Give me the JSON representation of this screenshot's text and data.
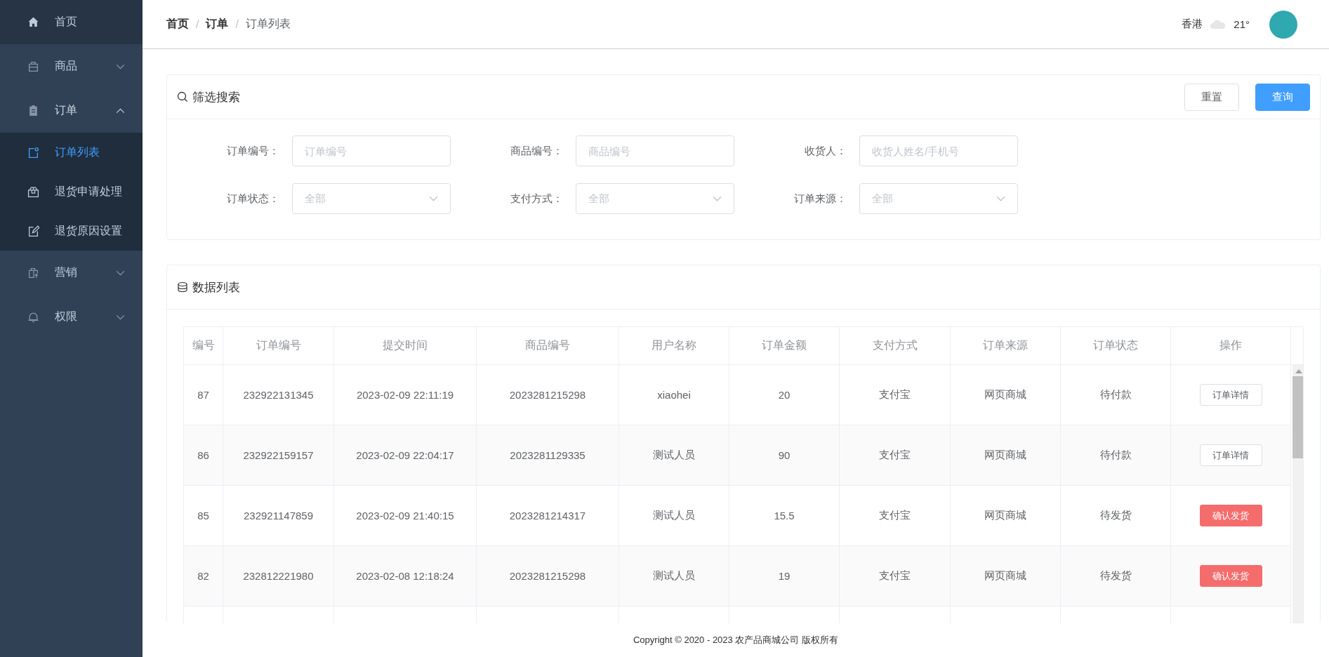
{
  "sidebar": {
    "items": [
      {
        "label": "首页",
        "selected": false
      },
      {
        "label": "商品",
        "expanded": false,
        "selected": false
      },
      {
        "label": "订单",
        "expanded": true,
        "selected": false,
        "children": [
          {
            "label": "订单列表",
            "selected": true
          },
          {
            "label": "退货申请处理",
            "selected": false
          },
          {
            "label": "退货原因设置",
            "selected": false
          }
        ]
      },
      {
        "label": "营销",
        "expanded": false,
        "selected": false
      },
      {
        "label": "权限",
        "expanded": false,
        "selected": false
      }
    ]
  },
  "breadcrumb": [
    {
      "label": "首页",
      "current": false
    },
    {
      "separator": "/",
      "label": "订单",
      "current": false
    },
    {
      "separator": "/",
      "label": "订单列表",
      "current": true
    }
  ],
  "header": {
    "city": "香港",
    "temperature": "21°"
  },
  "filter": {
    "title": "筛选搜索",
    "buttons": [
      {
        "label": "重置",
        "kind": "default"
      },
      {
        "label": "查询",
        "kind": "primary"
      }
    ],
    "fields": [
      {
        "label": "订单编号：",
        "kind": "input",
        "placeholder": "订单编号"
      },
      {
        "label": "商品编号：",
        "kind": "input",
        "placeholder": "商品编号"
      },
      {
        "label": "收货人：",
        "kind": "input",
        "placeholder": "收货人姓名/手机号"
      },
      {
        "label": "订单状态：",
        "kind": "select",
        "placeholder": "全部"
      },
      {
        "label": "支付方式：",
        "kind": "select",
        "placeholder": "全部"
      },
      {
        "label": "订单来源：",
        "kind": "select",
        "placeholder": "全部"
      }
    ]
  },
  "table": {
    "title": "数据列表",
    "columns": [
      "编号",
      "订单编号",
      "提交时间",
      "商品编号",
      "用户名称",
      "订单金额",
      "支付方式",
      "订单来源",
      "订单状态",
      "操作"
    ],
    "rows": [
      {
        "cells": [
          "87",
          "232922131345",
          "2023-02-09 22:11:19",
          "2023281215298",
          "xiaohei",
          "20",
          "支付宝",
          "网页商城",
          "待付款"
        ],
        "action": {
          "label": "订单详情",
          "kind": "detail"
        }
      },
      {
        "cells": [
          "86",
          "232922159157",
          "2023-02-09 22:04:17",
          "2023281129335",
          "测试人员",
          "90",
          "支付宝",
          "网页商城",
          "待付款"
        ],
        "action": {
          "label": "订单详情",
          "kind": "detail"
        }
      },
      {
        "cells": [
          "85",
          "232921147859",
          "2023-02-09 21:40:15",
          "2023281214317",
          "测试人员",
          "15.5",
          "支付宝",
          "网页商城",
          "待发货"
        ],
        "action": {
          "label": "确认发货",
          "kind": "ship"
        }
      },
      {
        "cells": [
          "82",
          "232812221980",
          "2023-02-08 12:18:24",
          "2023281215298",
          "测试人员",
          "19",
          "支付宝",
          "网页商城",
          "待发货"
        ],
        "action": {
          "label": "确认发货",
          "kind": "ship"
        }
      }
    ]
  },
  "footer": "Copyright © 2020 - 2023  农产品商城公司 版权所有"
}
